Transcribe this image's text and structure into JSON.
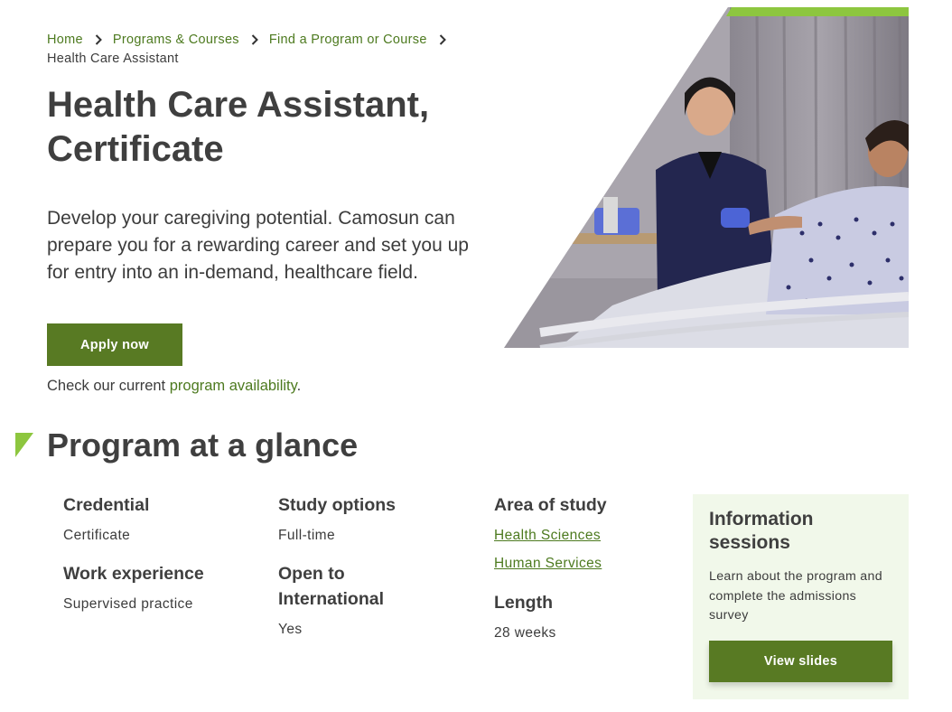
{
  "breadcrumb": {
    "items": [
      "Home",
      "Programs & Courses",
      "Find a Program or Course"
    ],
    "current": "Health Care Assistant"
  },
  "title": {
    "line1": "Health Care Assistant,",
    "line2": "Certificate"
  },
  "intro": "Develop your caregiving potential. Camosun can prepare you for a rewarding career and set you up for entry into an in-demand, healthcare field.",
  "apply_label": "Apply now",
  "availability": {
    "prefix": "Check our current ",
    "link": "program availability",
    "suffix": "."
  },
  "glance": {
    "title": "Program at a glance",
    "credential": {
      "label": "Credential",
      "value": "Certificate"
    },
    "work_experience": {
      "label": "Work experience",
      "value": "Supervised practice"
    },
    "study_options": {
      "label": "Study options",
      "value": "Full-time"
    },
    "international": {
      "label_line1": "Open to",
      "label_line2": "International",
      "value": "Yes"
    },
    "area_of_study": {
      "label": "Area of study",
      "links": [
        "Health Sciences",
        "Human Services"
      ]
    },
    "length": {
      "label": "Length",
      "value": "28 weeks"
    }
  },
  "info_sessions": {
    "title_line1": "Information",
    "title_line2": "sessions",
    "text": "Learn about the program and complete the admissions survey",
    "button_label": "View slides"
  },
  "colors": {
    "accent_green": "#587a23",
    "link_green": "#4d7a1f",
    "lime": "#8dc63f",
    "info_bg": "#f1f8ea"
  },
  "icons": [
    "chevron-right-icon",
    "green-flag-icon"
  ]
}
